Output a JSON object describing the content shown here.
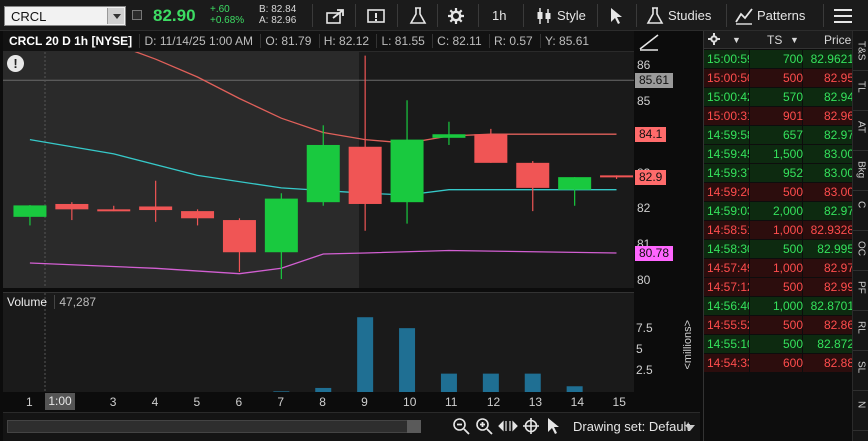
{
  "toolbar": {
    "symbol": "CRCL",
    "last_price": "82.90",
    "net_change": "+.60",
    "pct_change": "+0.68%",
    "bid": "B: 82.84",
    "ask": "A: 82.96",
    "interval_label": "1h",
    "style_label": "Style",
    "studies_label": "Studies",
    "patterns_label": "Patterns"
  },
  "chart_header": {
    "title": "CRCL 20 D 1h [NYSE]",
    "date": "D: 11/14/25 1:00 AM",
    "open": "O: 81.79",
    "high": "H: 82.12",
    "low": "L: 81.55",
    "close": "C: 82.11",
    "range": "R: 0.57",
    "y": "Y: 85.61"
  },
  "volume_header": {
    "label": "Volume",
    "value": "47,287"
  },
  "price_axis": {
    "ticks": [
      "86",
      "85",
      "84",
      "83",
      "82",
      "81",
      "80"
    ],
    "labels": [
      {
        "text": "85.61",
        "color": "#9a9a9a",
        "value": 85.61
      },
      {
        "text": "84.1",
        "color": "#ff6b6b",
        "value": 84.1
      },
      {
        "text": "82.9",
        "color": "#ff6b6b",
        "value": 82.9
      },
      {
        "text": "80.78",
        "color": "#ff66ff",
        "value": 80.78
      }
    ]
  },
  "volume_axis": {
    "ticks": [
      "7.5",
      "5",
      "2.5"
    ],
    "unit": "<millions>"
  },
  "time_axis": {
    "ticks": [
      "1",
      "3",
      "4",
      "5",
      "6",
      "7",
      "8",
      "9",
      "10",
      "11",
      "12",
      "13",
      "14",
      "15"
    ],
    "cursor_label": "1:00"
  },
  "chart_data": {
    "type": "candlestick",
    "x": [
      1,
      2,
      3,
      4,
      5,
      6,
      7,
      8,
      9,
      10,
      11,
      12,
      13,
      14,
      15
    ],
    "candles": [
      {
        "o": 81.79,
        "h": 82.12,
        "l": 81.55,
        "c": 82.11
      },
      {
        "o": 82.15,
        "h": 82.2,
        "l": 81.7,
        "c": 82.0
      },
      {
        "o": 82.0,
        "h": 82.1,
        "l": 81.95,
        "c": 81.98
      },
      {
        "o": 82.08,
        "h": 82.8,
        "l": 81.65,
        "c": 81.98
      },
      {
        "o": 81.95,
        "h": 82.0,
        "l": 81.55,
        "c": 81.75
      },
      {
        "o": 81.7,
        "h": 81.75,
        "l": 80.25,
        "c": 80.8
      },
      {
        "o": 80.8,
        "h": 82.45,
        "l": 80.05,
        "c": 82.3
      },
      {
        "o": 82.2,
        "h": 84.35,
        "l": 82.1,
        "c": 83.8
      },
      {
        "o": 83.75,
        "h": 86.3,
        "l": 81.4,
        "c": 82.15
      },
      {
        "o": 82.2,
        "h": 85.05,
        "l": 81.6,
        "c": 83.95
      },
      {
        "o": 84.0,
        "h": 84.45,
        "l": 83.8,
        "c": 84.1
      },
      {
        "o": 84.1,
        "h": 84.25,
        "l": 83.3,
        "c": 83.3
      },
      {
        "o": 83.3,
        "h": 83.35,
        "l": 81.95,
        "c": 82.6
      },
      {
        "o": 82.55,
        "h": 82.9,
        "l": 82.1,
        "c": 82.9
      },
      {
        "o": 82.95,
        "h": 82.95,
        "l": 82.85,
        "c": 82.9
      }
    ],
    "volume": [
      0,
      0,
      0,
      0,
      0,
      0,
      0.2,
      0.6,
      9.0,
      7.7,
      2.3,
      2.3,
      2.3,
      0.8,
      0
    ],
    "bands": {
      "upper": [
        {
          "x": 1,
          "y": 87.5
        },
        {
          "x": 4,
          "y": 86.2
        },
        {
          "x": 5,
          "y": 85.7
        },
        {
          "x": 6,
          "y": 85.1
        },
        {
          "x": 7,
          "y": 84.55
        },
        {
          "x": 8,
          "y": 84.15
        },
        {
          "x": 9,
          "y": 83.95
        },
        {
          "x": 10,
          "y": 83.85
        },
        {
          "x": 11,
          "y": 84.05
        },
        {
          "x": 12,
          "y": 84.1
        },
        {
          "x": 15,
          "y": 84.1
        }
      ],
      "middle": [
        {
          "x": 1,
          "y": 83.95
        },
        {
          "x": 3,
          "y": 83.55
        },
        {
          "x": 5,
          "y": 82.95
        },
        {
          "x": 7,
          "y": 82.6
        },
        {
          "x": 9,
          "y": 82.45
        },
        {
          "x": 10,
          "y": 82.4
        },
        {
          "x": 11,
          "y": 82.55
        },
        {
          "x": 12,
          "y": 82.55
        },
        {
          "x": 15,
          "y": 82.55
        }
      ],
      "lower": [
        {
          "x": 1,
          "y": 80.5
        },
        {
          "x": 4,
          "y": 80.35
        },
        {
          "x": 6,
          "y": 80.2
        },
        {
          "x": 7,
          "y": 80.35
        },
        {
          "x": 8,
          "y": 80.75
        },
        {
          "x": 9,
          "y": 80.78
        },
        {
          "x": 11,
          "y": 80.85
        },
        {
          "x": 15,
          "y": 80.78
        }
      ]
    },
    "ylim": [
      79.8,
      86.4
    ],
    "vol_ylim": [
      0,
      9.5
    ]
  },
  "time_sales": {
    "headers": [
      "TS",
      "Price"
    ],
    "rows": [
      {
        "time": "15:00:59",
        "size": "700",
        "price": "82.9621",
        "dir": "up"
      },
      {
        "time": "15:00:50",
        "size": "500",
        "price": "82.95",
        "dir": "dn"
      },
      {
        "time": "15:00:42",
        "size": "570",
        "price": "82.94",
        "dir": "up"
      },
      {
        "time": "15:00:31",
        "size": "901",
        "price": "82.96",
        "dir": "dn"
      },
      {
        "time": "14:59:58",
        "size": "657",
        "price": "82.97",
        "dir": "up"
      },
      {
        "time": "14:59:45",
        "size": "1,500",
        "price": "83.00",
        "dir": "up"
      },
      {
        "time": "14:59:37",
        "size": "952",
        "price": "83.00",
        "dir": "up"
      },
      {
        "time": "14:59:20",
        "size": "500",
        "price": "83.00",
        "dir": "dn"
      },
      {
        "time": "14:59:03",
        "size": "2,000",
        "price": "82.97",
        "dir": "up"
      },
      {
        "time": "14:58:51",
        "size": "1,000",
        "price": "82.9328",
        "dir": "dn"
      },
      {
        "time": "14:58:30",
        "size": "500",
        "price": "82.995",
        "dir": "up"
      },
      {
        "time": "14:57:49",
        "size": "1,000",
        "price": "82.97",
        "dir": "dn"
      },
      {
        "time": "14:57:12",
        "size": "500",
        "price": "82.99",
        "dir": "dn"
      },
      {
        "time": "14:56:40",
        "size": "1,000",
        "price": "82.8701",
        "dir": "up"
      },
      {
        "time": "14:55:52",
        "size": "500",
        "price": "82.86",
        "dir": "dn"
      },
      {
        "time": "14:55:10",
        "size": "500",
        "price": "82.872",
        "dir": "up"
      },
      {
        "time": "14:54:33",
        "size": "600",
        "price": "82.88",
        "dir": "dn"
      }
    ]
  },
  "side_tabs": [
    "T&S",
    "TL",
    "AT",
    "Bkg",
    "C",
    "OC",
    "PF",
    "RL",
    "SL",
    "N"
  ],
  "bottom_bar": {
    "drawing_set": "Drawing set: Default"
  },
  "colors": {
    "up": "#19c93f",
    "down": "#f05555",
    "upper_band": "#e0605a",
    "middle_band": "#36c9c9",
    "lower_band": "#d25fd2",
    "volume": "#1f6f93"
  }
}
